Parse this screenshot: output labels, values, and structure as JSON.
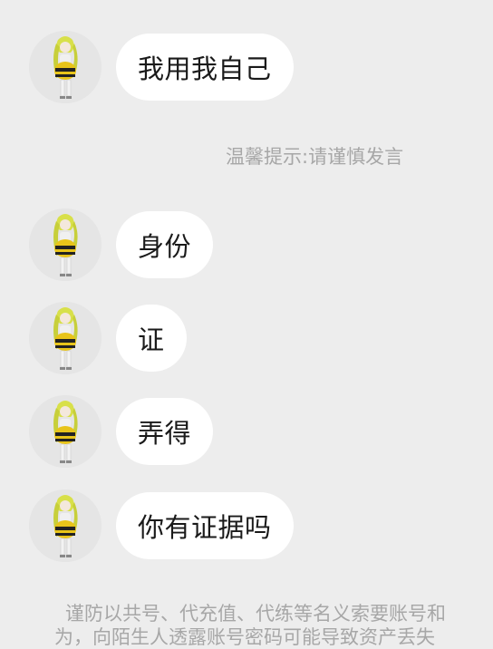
{
  "messages": [
    {
      "text": "我用我自己"
    },
    {
      "text": "身份"
    },
    {
      "text": "证"
    },
    {
      "text": "弄得"
    },
    {
      "text": "你有证据吗"
    }
  ],
  "system_tip": "温馨提示:请谨慎发言",
  "warning": {
    "line1": "谨防以共号、代充值、代练等名义索要账号和",
    "line2": "为，向陌生人透露账号密码可能导致资产丢失"
  },
  "colors": {
    "background": "#ededed",
    "bubble": "#ffffff",
    "tip_text": "#a7a7a7"
  }
}
